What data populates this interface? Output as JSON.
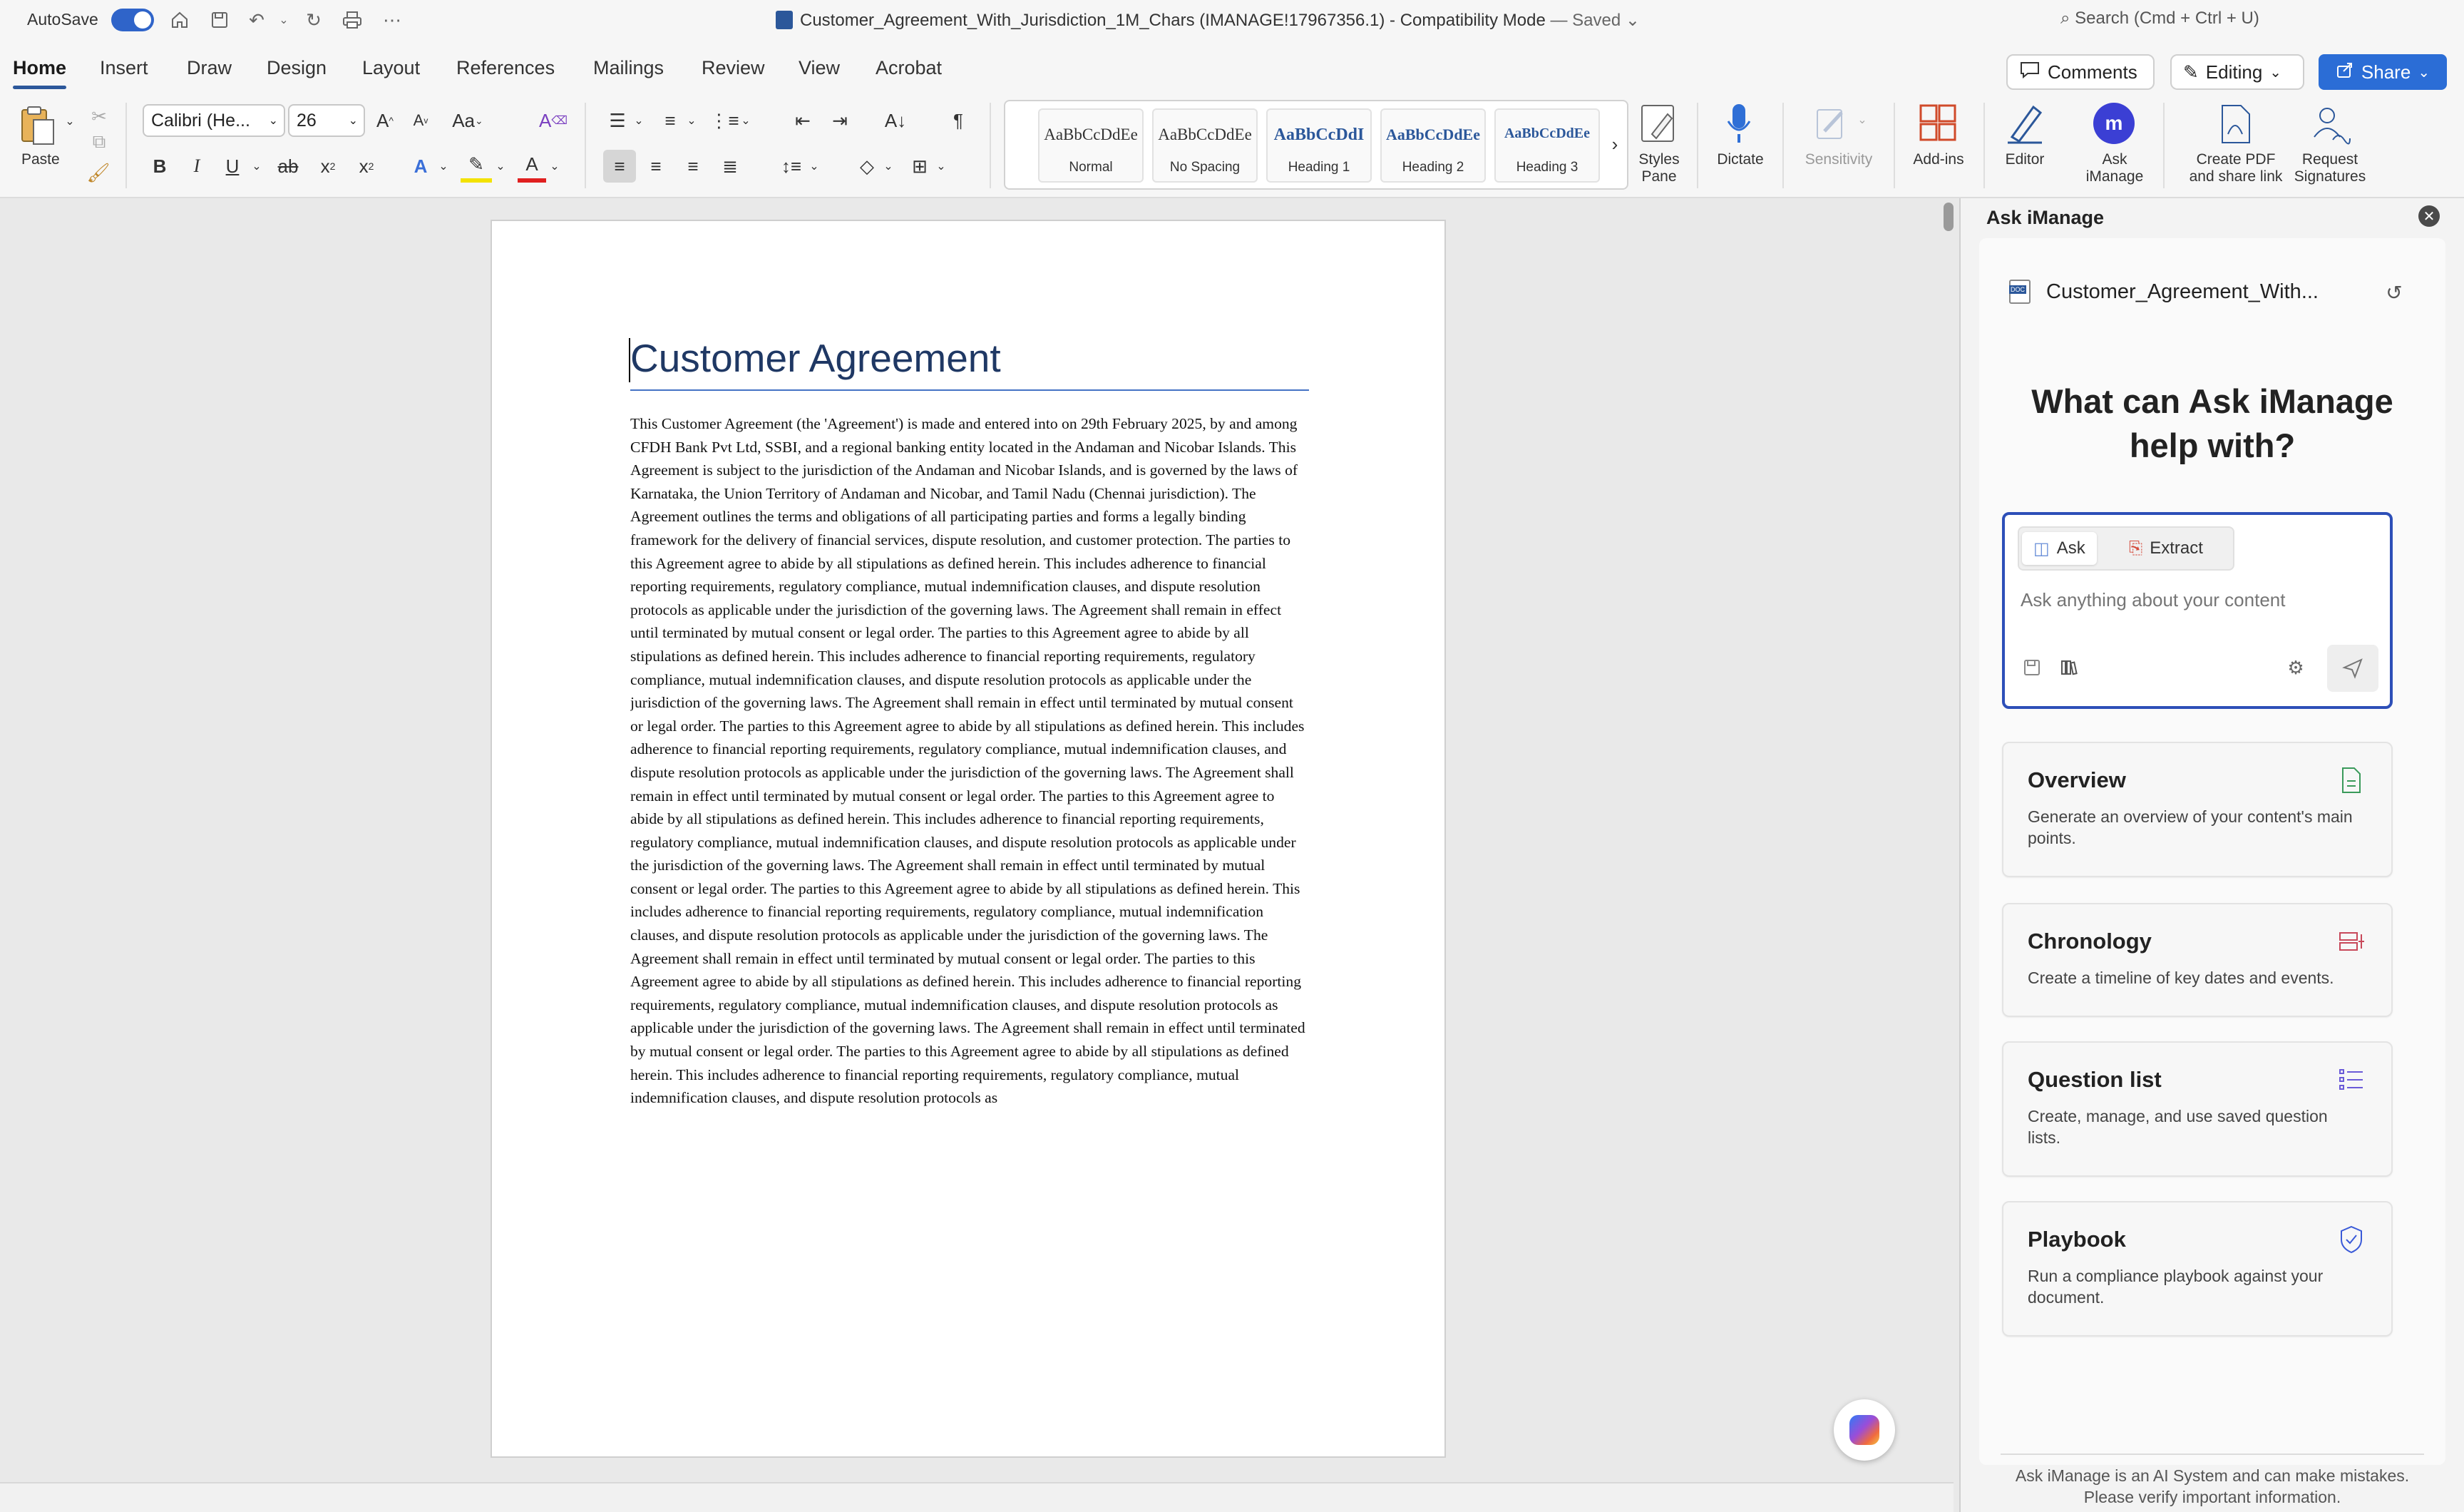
{
  "titlebar": {
    "autosave_label": "AutoSave",
    "document_title": "Customer_Agreement_With_Jurisdiction_1M_Chars (IMANAGE!17967356.1)",
    "mode_separator": "-",
    "compatibility": "Compatibility Mode",
    "save_status": "— Saved",
    "search_placeholder": "Search (Cmd + Ctrl + U)"
  },
  "tabs": [
    "Home",
    "Insert",
    "Draw",
    "Design",
    "Layout",
    "References",
    "Mailings",
    "Review",
    "View",
    "Acrobat"
  ],
  "top_actions": {
    "comments": "Comments",
    "editing": "Editing",
    "share": "Share"
  },
  "ribbon": {
    "paste": "Paste",
    "font_name": "Calibri (He...",
    "font_size": "26",
    "styles": [
      {
        "sample": "AaBbCcDdEe",
        "name": "Normal"
      },
      {
        "sample": "AaBbCcDdEe",
        "name": "No Spacing"
      },
      {
        "sample": "AaBbCcDdI",
        "name": "Heading 1"
      },
      {
        "sample": "AaBbCcDdEe",
        "name": "Heading 2"
      },
      {
        "sample": "AaBbCcDdEe",
        "name": "Heading 3"
      }
    ],
    "styles_pane": "Styles\nPane",
    "dictate": "Dictate",
    "sensitivity": "Sensitivity",
    "addins": "Add-ins",
    "editor": "Editor",
    "ask_imanage": "Ask\niManage",
    "create_pdf": "Create PDF\nand share link",
    "request_signatures": "Request\nSignatures"
  },
  "document": {
    "heading": "Customer Agreement",
    "body": "This Customer Agreement (the 'Agreement') is made and entered into on 29th February 2025, by and among CFDH Bank Pvt Ltd, SSBI, and a regional banking entity located in the Andaman and Nicobar Islands. This Agreement is subject to the jurisdiction of the Andaman and Nicobar Islands, and is governed by the laws of Karnataka, the Union Territory of Andaman and Nicobar, and Tamil Nadu (Chennai jurisdiction). The Agreement outlines the terms and obligations of all participating parties and forms a legally binding framework for the delivery of financial services, dispute resolution, and customer protection. The parties to this Agreement agree to abide by all stipulations as defined herein. This includes adherence to financial reporting requirements, regulatory compliance, mutual indemnification clauses, and dispute resolution protocols as applicable under the jurisdiction of the governing laws. The Agreement shall remain in effect until terminated by mutual consent or legal order. The parties to this Agreement agree to abide by all stipulations as defined herein. This includes adherence to financial reporting requirements, regulatory compliance, mutual indemnification clauses, and dispute resolution protocols as applicable under the jurisdiction of the governing laws. The Agreement shall remain in effect until terminated by mutual consent or legal order. The parties to this Agreement agree to abide by all stipulations as defined herein. This includes adherence to financial reporting requirements, regulatory compliance, mutual indemnification clauses, and dispute resolution protocols as applicable under the jurisdiction of the governing laws. The Agreement shall remain in effect until terminated by mutual consent or legal order. The parties to this Agreement agree to abide by all stipulations as defined herein. This includes adherence to financial reporting requirements, regulatory compliance, mutual indemnification clauses, and dispute resolution protocols as applicable under the jurisdiction of the governing laws. The Agreement shall remain in effect until terminated by mutual consent or legal order. The parties to this Agreement agree to abide by all stipulations as defined herein. This includes adherence to financial reporting requirements, regulatory compliance, mutual indemnification clauses, and dispute resolution protocols as applicable under the jurisdiction of the governing laws. The Agreement shall remain in effect until terminated by mutual consent or legal order. The parties to this Agreement agree to abide by all stipulations as defined herein. This includes adherence to financial reporting requirements, regulatory compliance, mutual indemnification clauses, and dispute resolution protocols as applicable under the jurisdiction of the governing laws. The Agreement shall remain in effect until terminated by mutual consent or legal order. The parties to this Agreement agree to abide by all stipulations as defined herein. This includes adherence to financial reporting requirements, regulatory compliance, mutual indemnification clauses, and dispute resolution protocols as"
  },
  "panel": {
    "title": "Ask iManage",
    "doc_name": "Customer_Agreement_With...",
    "heading": "What can Ask iManage help with?",
    "modes": {
      "ask": "Ask",
      "extract": "Extract"
    },
    "input_placeholder": "Ask anything about your content",
    "cards": [
      {
        "title": "Overview",
        "desc": "Generate an overview of your content's main points."
      },
      {
        "title": "Chronology",
        "desc": "Create a timeline of key dates and events."
      },
      {
        "title": "Question list",
        "desc": "Create, manage, and use saved question lists."
      },
      {
        "title": "Playbook",
        "desc": "Run a compliance playbook against your document."
      }
    ],
    "disclaimer": "Ask iManage is an AI System and can make mistakes. Please verify important information."
  },
  "colors": {
    "accent": "#2b579a",
    "share_button": "#2b6dd6",
    "ask_box_border": "#2d4fb8",
    "heading_text": "#1f3864"
  }
}
